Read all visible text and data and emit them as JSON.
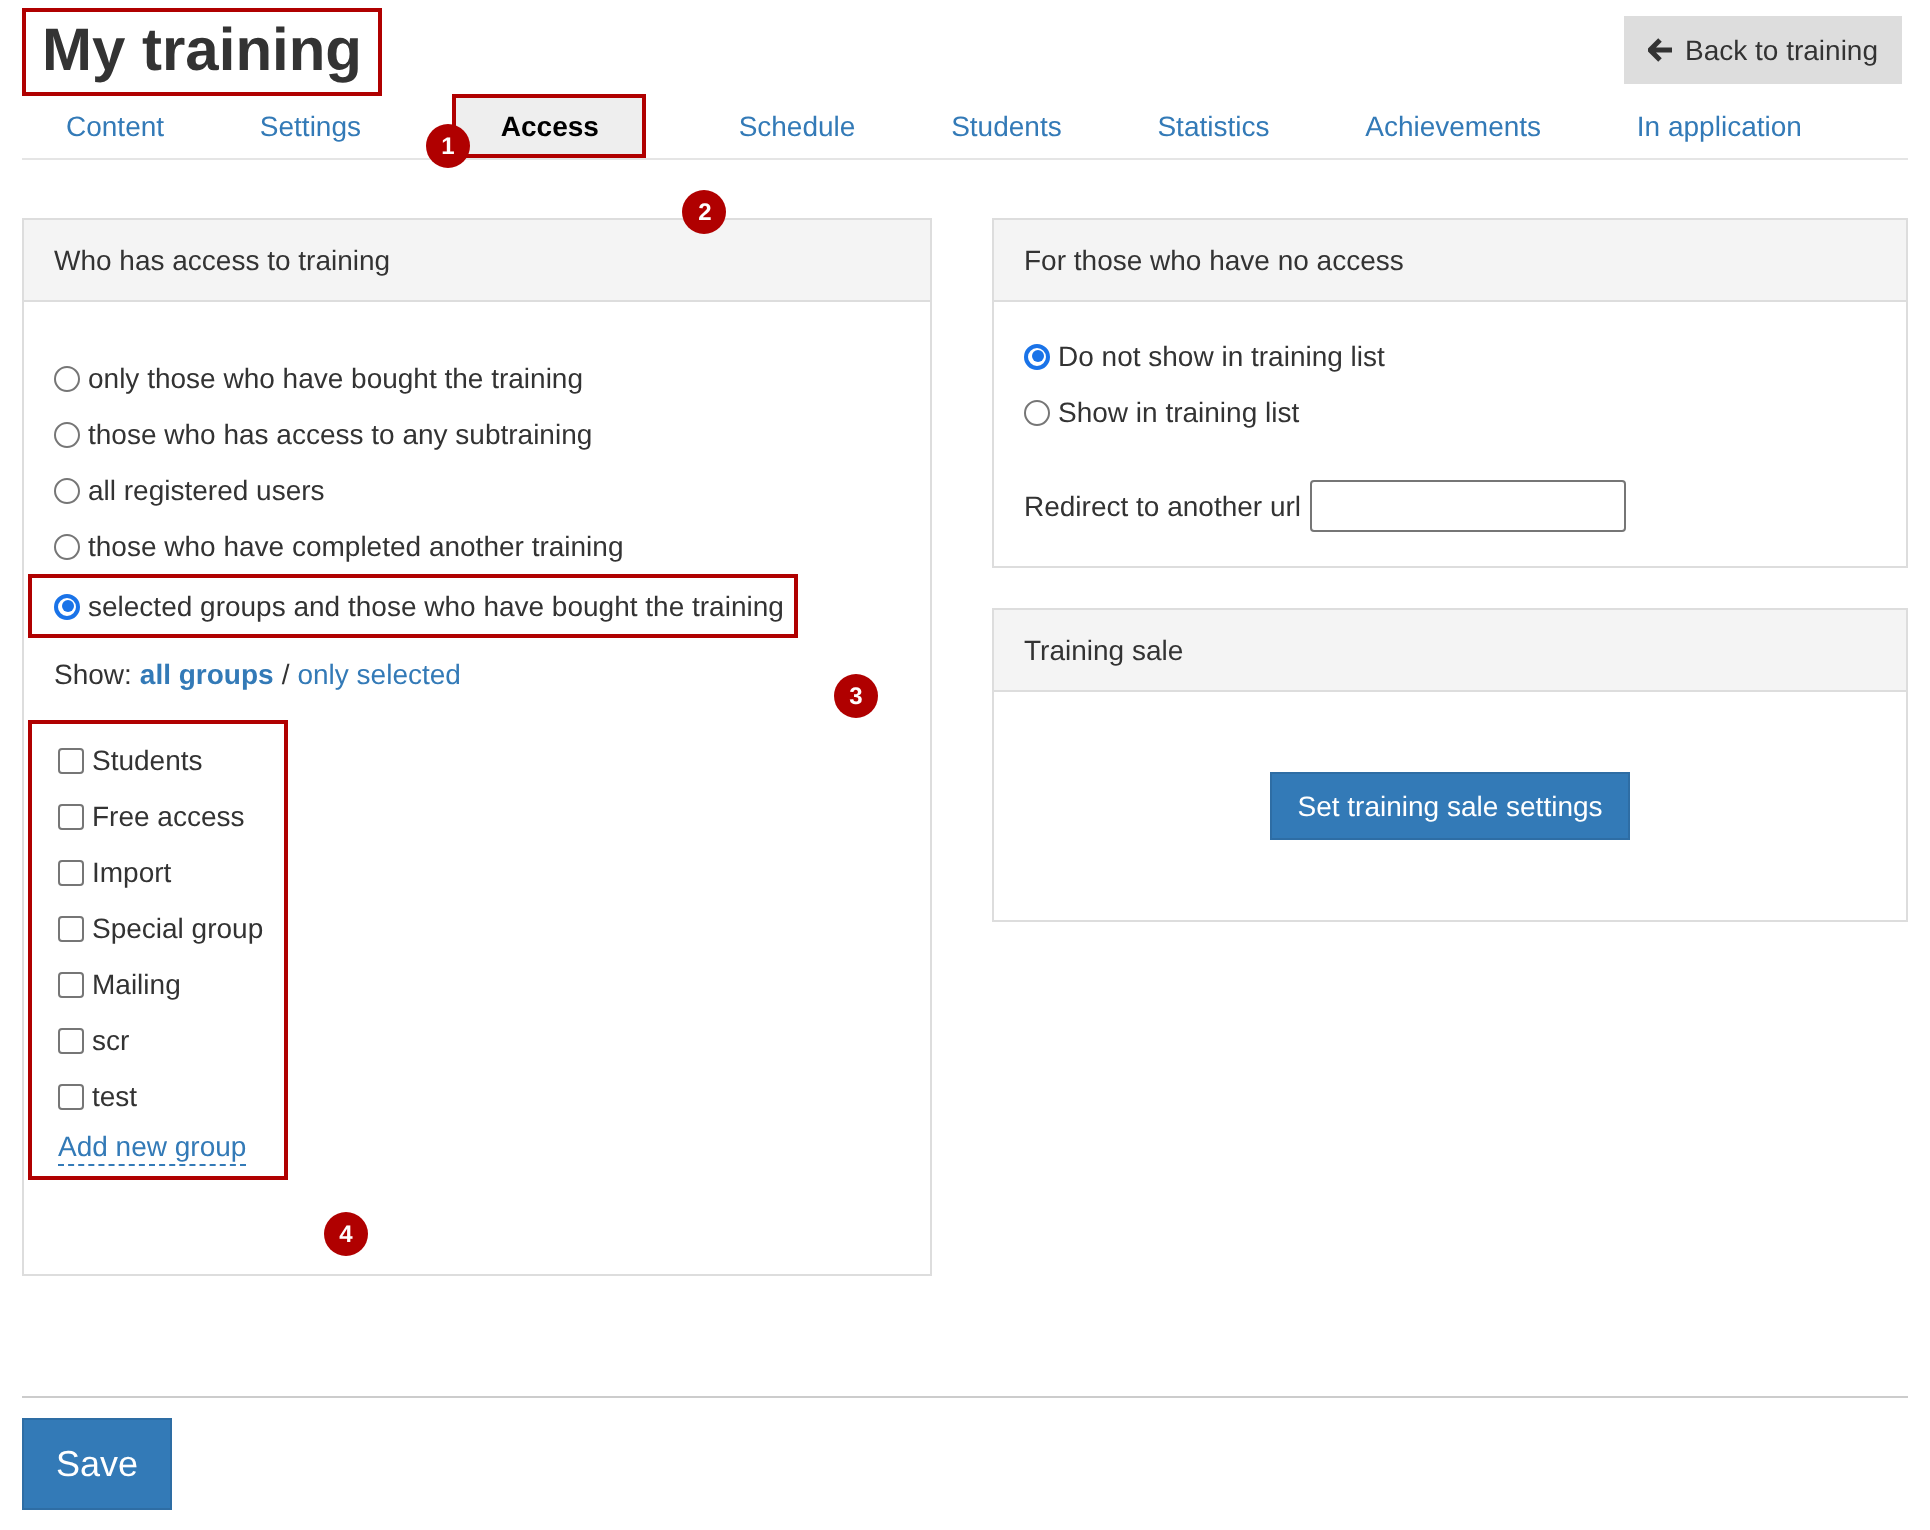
{
  "title": {
    "text": "My training",
    "callout": "1"
  },
  "back_button": {
    "label": "Back to training"
  },
  "tabs": [
    {
      "label": "Content",
      "selected": false
    },
    {
      "label": "Settings",
      "selected": false
    },
    {
      "label": "Access",
      "selected": true,
      "callout": "2"
    },
    {
      "label": "Schedule",
      "selected": false
    },
    {
      "label": "Students",
      "selected": false
    },
    {
      "label": "Statistics",
      "selected": false
    },
    {
      "label": "Achievements",
      "selected": false
    },
    {
      "label": "In application",
      "selected": false
    }
  ],
  "access_panel": {
    "title": "Who has access to training",
    "options": [
      {
        "label": "only those who have bought the training",
        "selected": false
      },
      {
        "label": "those who has access to any subtraining",
        "selected": false
      },
      {
        "label": "all registered users",
        "selected": false
      },
      {
        "label": "those who have completed another training",
        "selected": false
      },
      {
        "label": "selected groups and those who have bought the training",
        "selected": true,
        "callout": "3"
      }
    ],
    "show_label": "Show:",
    "show_filters": [
      {
        "label": "all groups",
        "selected": true
      },
      {
        "label": "only selected",
        "selected": false
      }
    ],
    "separator": "/",
    "groups": [
      {
        "label": "Students",
        "checked": false
      },
      {
        "label": "Free access",
        "checked": false
      },
      {
        "label": "Import",
        "checked": false
      },
      {
        "label": "Special group",
        "checked": false
      },
      {
        "label": "Mailing",
        "checked": false
      },
      {
        "label": "scr",
        "checked": false
      },
      {
        "label": "test",
        "checked": false
      }
    ],
    "add_group_link": "Add new group",
    "groups_callout": "4"
  },
  "no_access_panel": {
    "title": "For those who have no access",
    "options": [
      {
        "label": "Do not show in training list",
        "selected": true
      },
      {
        "label": "Show in training list",
        "selected": false
      }
    ],
    "redirect_label": "Redirect to another url"
  },
  "sale_panel": {
    "title": "Training sale",
    "button": "Set training sale settings"
  },
  "save_button": "Save"
}
